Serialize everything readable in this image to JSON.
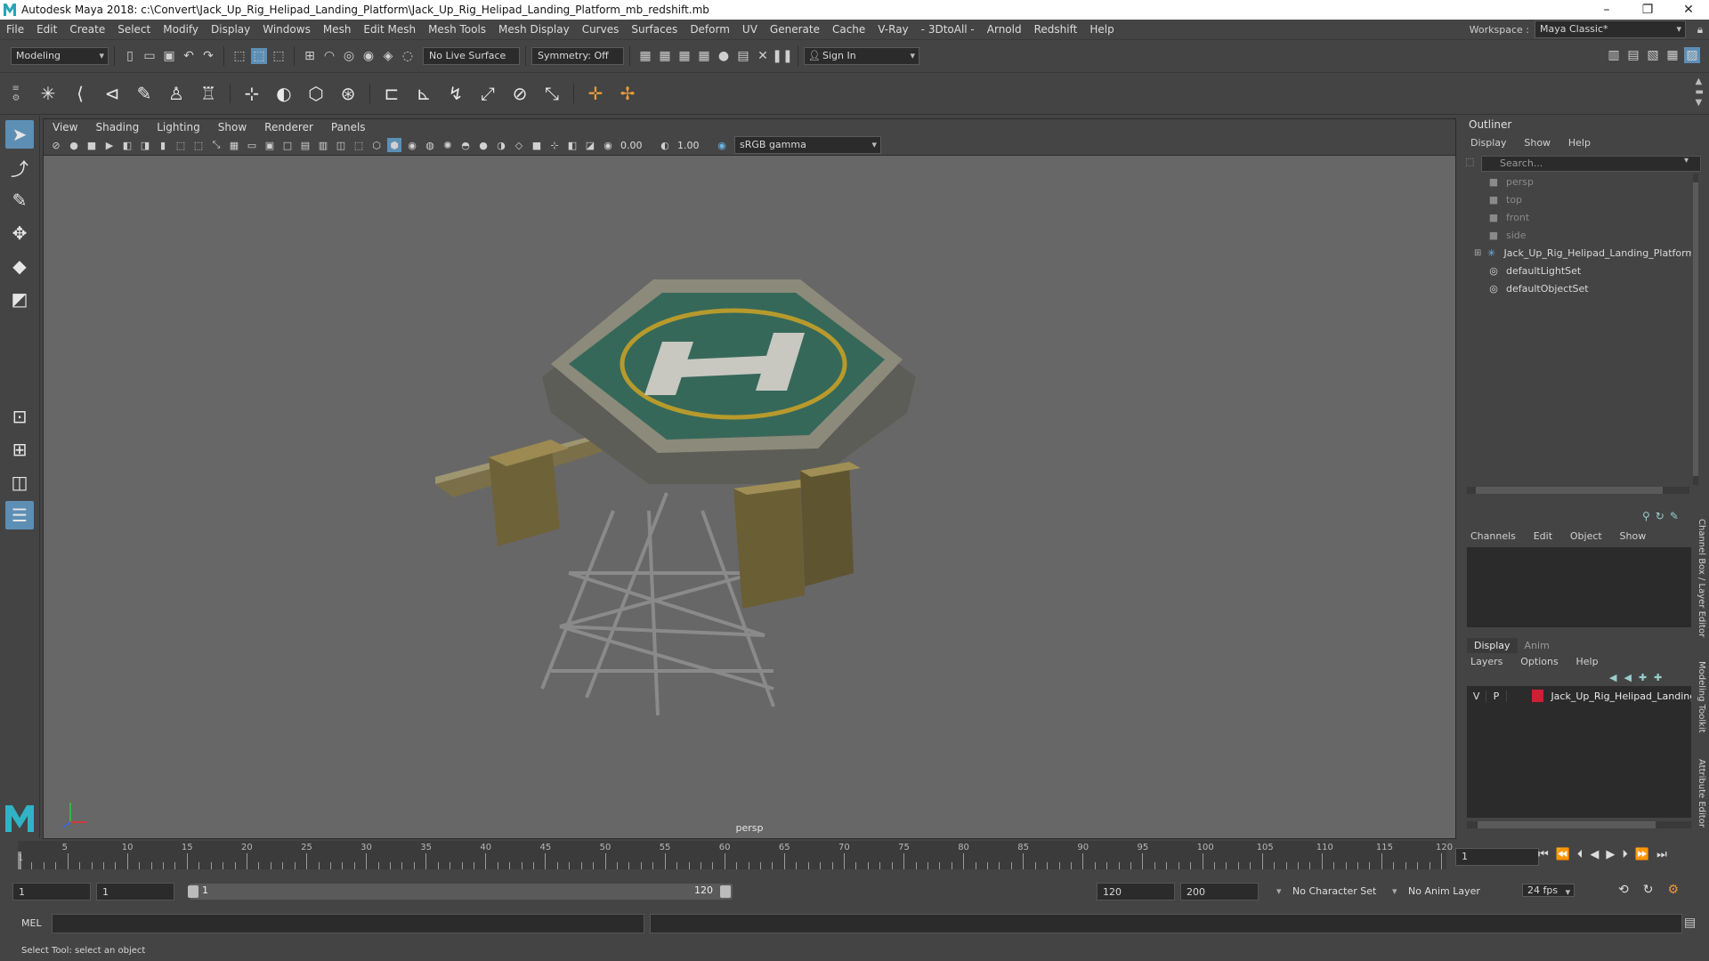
{
  "window": {
    "title": "Autodesk Maya 2018: c:\\Convert\\Jack_Up_Rig_Helipad_Landing_Platform\\Jack_Up_Rig_Helipad_Landing_Platform_mb_redshift.mb",
    "minimize": "–",
    "maximize": "❐",
    "close": "✕"
  },
  "menubar": {
    "items": [
      "File",
      "Edit",
      "Create",
      "Select",
      "Modify",
      "Display",
      "Windows",
      "Mesh",
      "Edit Mesh",
      "Mesh Tools",
      "Mesh Display",
      "Curves",
      "Surfaces",
      "Deform",
      "UV",
      "Generate",
      "Cache",
      "V-Ray",
      "- 3DtoAll -",
      "Arnold",
      "Redshift",
      "Help"
    ],
    "workspace_label": "Workspace :",
    "workspace_value": "Maya Classic*"
  },
  "statusline": {
    "mode": "Modeling",
    "live_surface": "No Live Surface",
    "symmetry": "Symmetry: Off",
    "sign_in": "Sign In"
  },
  "viewport": {
    "menu": [
      "View",
      "Shading",
      "Lighting",
      "Show",
      "Renderer",
      "Panels"
    ],
    "exposure": "0.00",
    "gamma": "1.00",
    "color_space": "sRGB gamma",
    "camera_label": "persp"
  },
  "outliner": {
    "title": "Outliner",
    "menu": [
      "Display",
      "Show",
      "Help"
    ],
    "search_placeholder": "Search...",
    "items": [
      {
        "label": "persp",
        "kind": "camera"
      },
      {
        "label": "top",
        "kind": "camera"
      },
      {
        "label": "front",
        "kind": "camera"
      },
      {
        "label": "side",
        "kind": "camera"
      },
      {
        "label": "Jack_Up_Rig_Helipad_Landing_Platform",
        "kind": "group"
      },
      {
        "label": "defaultLightSet",
        "kind": "set"
      },
      {
        "label": "defaultObjectSet",
        "kind": "set"
      }
    ]
  },
  "channelbox": {
    "menu": [
      "Channels",
      "Edit",
      "Object",
      "Show"
    ]
  },
  "layer_editor": {
    "tabs": [
      "Display",
      "Anim"
    ],
    "menu": [
      "Layers",
      "Options",
      "Help"
    ],
    "layer": {
      "v": "V",
      "p": "P",
      "name": "Jack_Up_Rig_Helipad_Landing",
      "color": "#d01e35"
    }
  },
  "side_tabs": [
    "Channel Box / Layer Editor",
    "Modeling Toolkit",
    "Attribute Editor"
  ],
  "timeslider": {
    "ticks": [
      1,
      5,
      10,
      15,
      20,
      25,
      30,
      35,
      40,
      45,
      50,
      55,
      60,
      65,
      70,
      75,
      80,
      85,
      90,
      95,
      100,
      105,
      110,
      115,
      120
    ],
    "current_frame": "1"
  },
  "range": {
    "start": "1",
    "anim_start": "1",
    "range_start": "1",
    "range_end": "120",
    "end": "120",
    "anim_end": "200",
    "character_set": "No Character Set",
    "anim_layer": "No Anim Layer",
    "fps": "24 fps"
  },
  "cmdline": {
    "label": "MEL"
  },
  "helpline": {
    "text": "Select Tool: select an object"
  }
}
